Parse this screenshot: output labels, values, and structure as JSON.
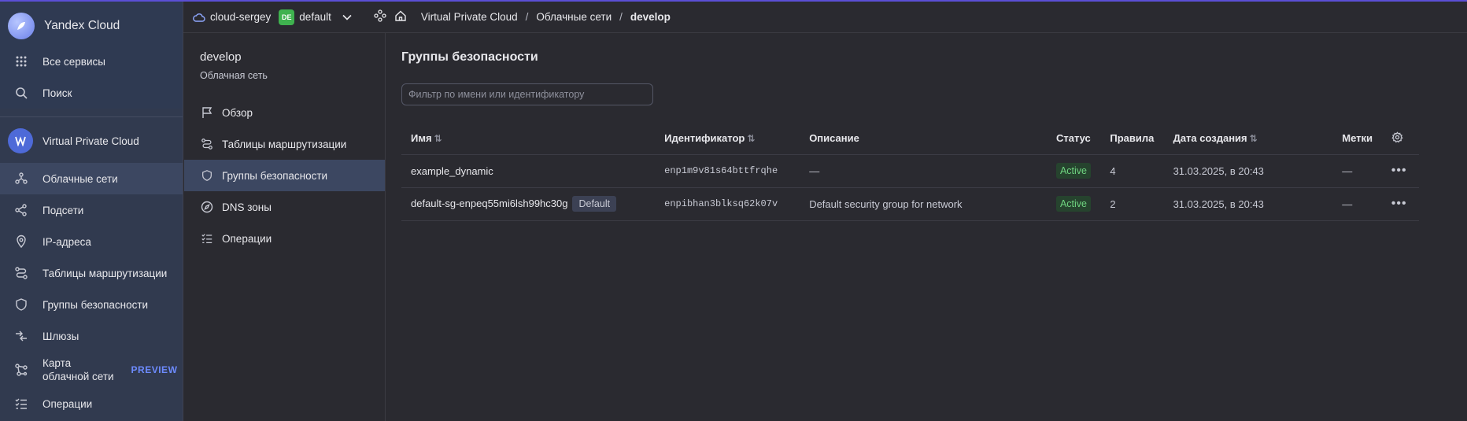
{
  "brand": {
    "title": "Yandex Cloud"
  },
  "nav": {
    "all_services": "Все сервисы",
    "search": "Поиск",
    "service_title": "Virtual Private Cloud",
    "items": [
      {
        "label": "Облачные сети",
        "icon": "cloud-networks-icon",
        "active": true
      },
      {
        "label": "Подсети",
        "icon": "subnets-icon"
      },
      {
        "label": "IP-адреса",
        "icon": "location-pin-icon"
      },
      {
        "label": "Таблицы маршрутизации",
        "icon": "route-icon"
      },
      {
        "label": "Группы безопасности",
        "icon": "shield-icon"
      },
      {
        "label": "Шлюзы",
        "icon": "gateway-icon"
      },
      {
        "label_line1": "Карта",
        "label_line2": "облачной сети",
        "badge": "PREVIEW",
        "icon": "network-map-icon"
      },
      {
        "label": "Операции",
        "icon": "operations-list-icon"
      }
    ]
  },
  "header": {
    "cloud": "cloud-sergey",
    "folder_badge": "DE",
    "folder": "default",
    "breadcrumb": [
      "Virtual Private Cloud",
      "Облачные сети",
      "develop"
    ],
    "separator": "/"
  },
  "subnav": {
    "title": "develop",
    "subtitle": "Облачная сеть",
    "items": [
      {
        "label": "Обзор",
        "icon": "flag-icon"
      },
      {
        "label": "Таблицы маршрутизации",
        "icon": "route-icon"
      },
      {
        "label": "Группы безопасности",
        "icon": "shield-icon",
        "active": true
      },
      {
        "label": "DNS зоны",
        "icon": "compass-icon"
      },
      {
        "label": "Операции",
        "icon": "operations-list-icon"
      }
    ]
  },
  "main": {
    "title": "Группы безопасности",
    "filter_placeholder": "Фильтр по имени или идентификатору",
    "columns": {
      "name": "Имя",
      "id": "Идентификатор",
      "description": "Описание",
      "status": "Статус",
      "rules": "Правила",
      "created": "Дата создания",
      "labels": "Метки"
    },
    "rows": [
      {
        "name": "example_dynamic",
        "badge": "",
        "id": "enp1m9v81s64bttfrqhe",
        "description": "—",
        "status": "Active",
        "rules": "4",
        "created": "31.03.2025, в 20:43",
        "labels": "—"
      },
      {
        "name": "default-sg-enpeq55mi6lsh99hc30g",
        "badge": "Default",
        "id": "enpibhan3blksq62k07v",
        "description": "Default security group for network",
        "status": "Active",
        "rules": "2",
        "created": "31.03.2025, в 20:43",
        "labels": "—"
      }
    ]
  },
  "colors": {
    "accent": "#5b4fd6",
    "nav_bg": "#313a4f",
    "active_bg": "#3c4761",
    "status_green": "#6fd480",
    "folder_badge": "#3fb24f"
  }
}
